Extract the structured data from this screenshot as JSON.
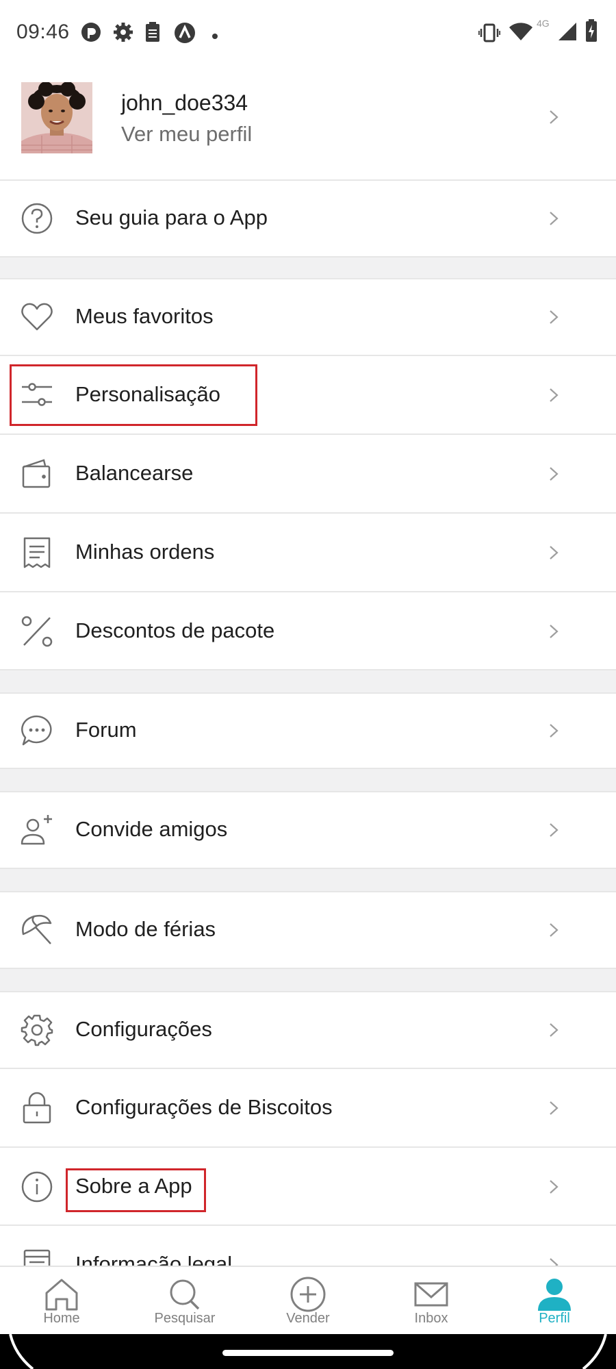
{
  "status_bar": {
    "time": "09:46",
    "left_icons": [
      "app-badge-icon",
      "gear-icon",
      "clipboard-icon",
      "arrow-badge-icon",
      "dot-icon"
    ],
    "right_icons": [
      "vibrate-icon",
      "wifi-icon",
      "signal-icon",
      "battery-icon"
    ],
    "network": "4G"
  },
  "profile": {
    "username": "john_doe334",
    "subtitle": "Ver meu perfil"
  },
  "menu": {
    "guide": "Seu guia para o App",
    "favorites": "Meus favoritos",
    "personalization": "Personalisação",
    "balance": "Balancearse",
    "orders": "Minhas ordens",
    "bundle_discounts": "Descontos de pacote",
    "forum": "Forum",
    "invite": "Convide amigos",
    "vacation": "Modo de férias",
    "settings": "Configurações",
    "cookie_settings": "Configurações de Biscoitos",
    "about": "Sobre a App",
    "legal": "Informação legal"
  },
  "bottom_nav": {
    "home": "Home",
    "search": "Pesquisar",
    "sell": "Vender",
    "inbox": "Inbox",
    "profile": "Perfil",
    "active": "Perfil"
  },
  "colors": {
    "accent": "#1fb1c4",
    "highlight_box": "#d0262b",
    "divider": "#e6e6e6",
    "section_gap": "#f1f1f2"
  }
}
